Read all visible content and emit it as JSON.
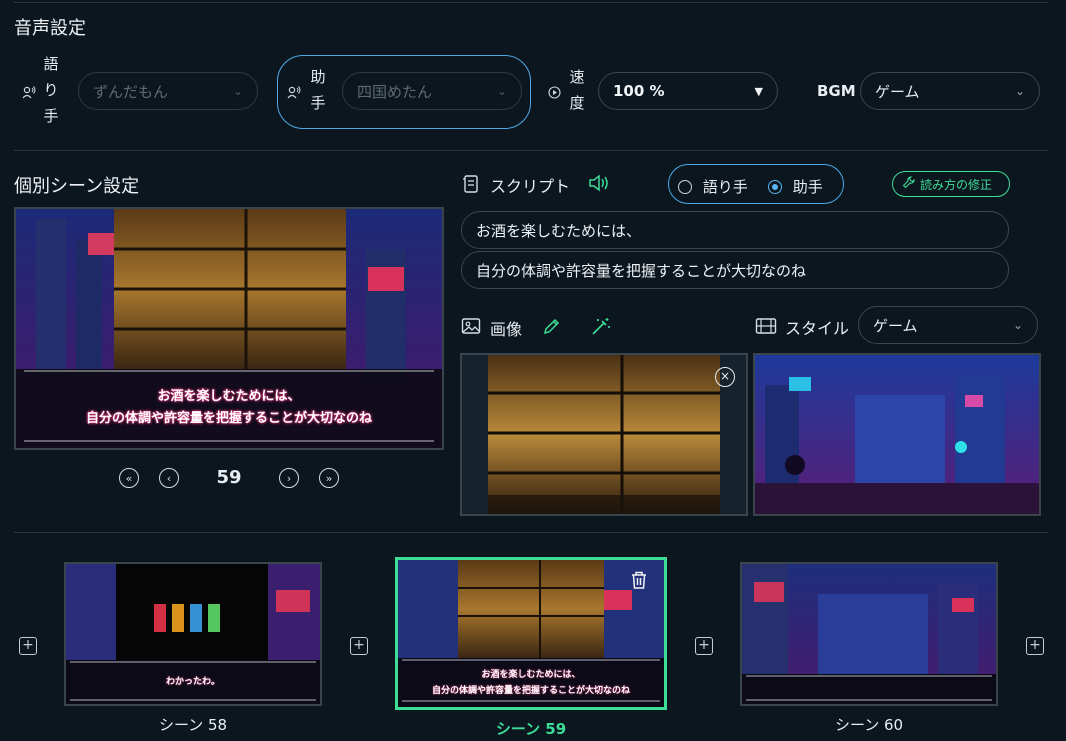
{
  "voice": {
    "title": "音声設定",
    "narrator_label": "語り手",
    "narrator_value": "ずんだもん",
    "assistant_label": "助手",
    "assistant_value": "四国めたん",
    "speed_label": "速度",
    "speed_value": "100 %",
    "bgm_label": "BGM",
    "bgm_value": "ゲーム"
  },
  "scene": {
    "title": "個別シーン設定",
    "current": "59",
    "caption_line1": "お酒を楽しむためには、",
    "caption_line2": "自分の体調や許容量を把握することが大切なのね"
  },
  "script": {
    "label": "スクリプト",
    "radio_narrator": "語り手",
    "radio_assistant": "助手",
    "selected": "助手",
    "fix_reading": "読み方の修正",
    "line1": "お酒を楽しむためには、",
    "line2": "自分の体調や許容量を把握することが大切なのね"
  },
  "image": {
    "label": "画像"
  },
  "style": {
    "label": "スタイル",
    "value": "ゲーム"
  },
  "timeline": {
    "scenes": [
      {
        "label": "シーン 58",
        "caption": "わかったわ。"
      },
      {
        "label": "シーン 59",
        "caption_line1": "お酒を楽しむためには、",
        "caption_line2": "自分の体調や許容量を把握することが大切なのね"
      },
      {
        "label": "シーン 60"
      }
    ]
  },
  "colors": {
    "accent_blue": "#4fa9e6",
    "accent_green": "#3ddc97",
    "bg": "#0b161f"
  }
}
